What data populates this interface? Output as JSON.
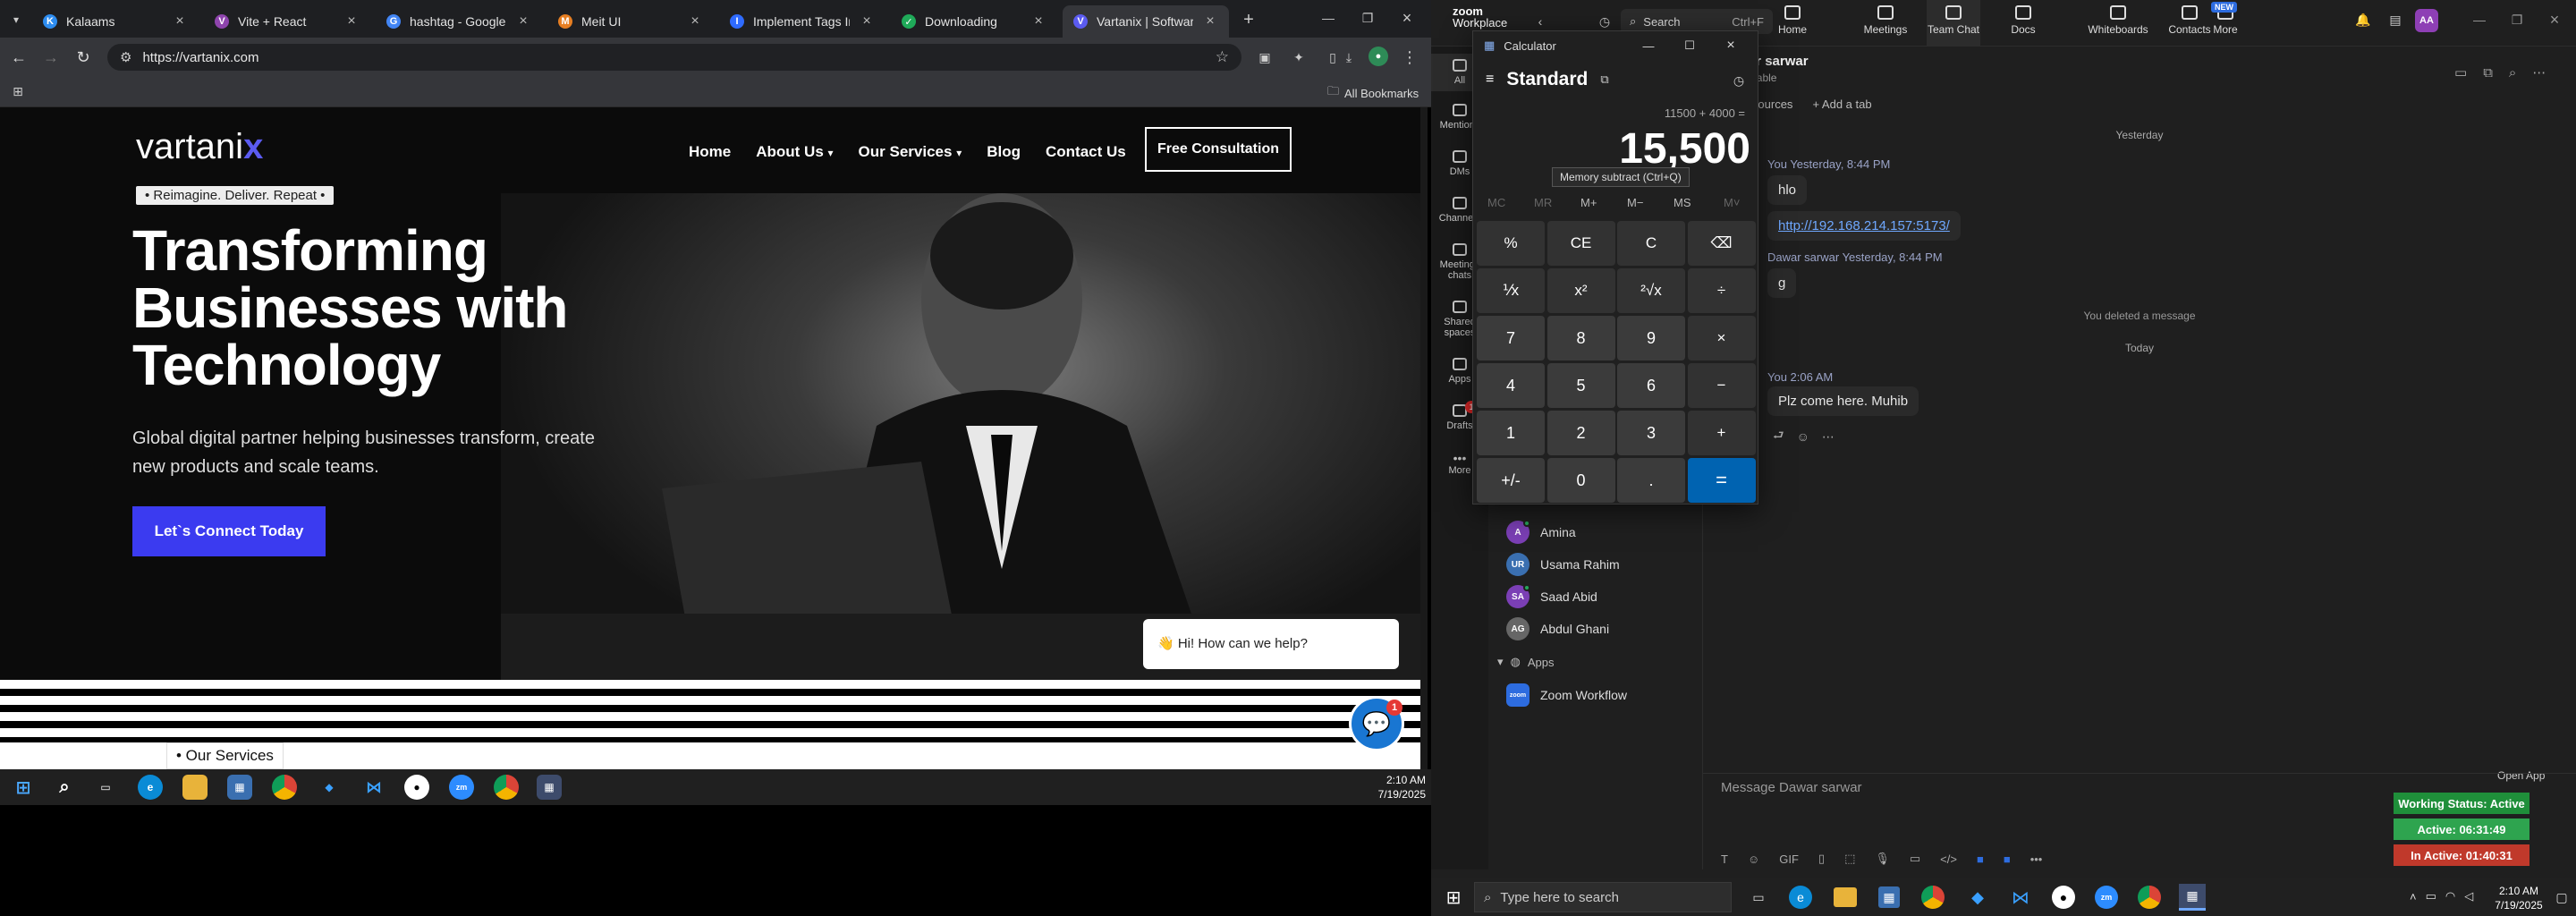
{
  "browser": {
    "tabs": [
      {
        "title": "Kalaams",
        "color": "#2d8cf0"
      },
      {
        "title": "Vite + React",
        "color": "#8e44ad"
      },
      {
        "title": "hashtag - Google Sear",
        "color": "#4285f4"
      },
      {
        "title": "Meit UI",
        "color": "#e67e22"
      },
      {
        "title": "Implement Tags Input",
        "color": "#2f6bff"
      },
      {
        "title": "Downloading",
        "color": "#1faa59"
      },
      {
        "title": "Vartanix | Software De",
        "color": "#5b5bf0"
      }
    ],
    "url": "https://vartanix.com",
    "all_bookmarks": "All Bookmarks"
  },
  "site": {
    "logo_main": "vartani",
    "logo_x": "x",
    "nav": [
      "Home",
      "About Us",
      "Our Services",
      "Blog",
      "Contact Us"
    ],
    "nav_dropdowns": [
      false,
      true,
      true,
      false,
      false
    ],
    "cta": "Free Consultation",
    "tagline": "• Reimagine. Deliver. Repeat •",
    "hero_line1": "Transforming",
    "hero_line2": "Businesses with",
    "hero_line3": "Technology",
    "sub_line1": "Global digital partner helping businesses transform, create",
    "sub_line2": "new products and scale teams.",
    "connect": "Let`s Connect Today",
    "chat_bubble": "👋 Hi! How can we help?",
    "chat_badge": "1",
    "services_tag": "• Our Services"
  },
  "left_taskbar": {
    "time": "2:10 AM",
    "date": "7/19/2025"
  },
  "zoom": {
    "brand_top": "zoom",
    "brand_bottom": "Workplace",
    "search": "Search",
    "shortcut": "Ctrl+F",
    "tabs": [
      "Home",
      "Meetings",
      "Team Chat",
      "Docs",
      "Whiteboards",
      "Contacts",
      "More"
    ],
    "new_badge": "NEW",
    "avatar": "AA",
    "side": [
      "All",
      "Mentions",
      "DMs",
      "Channels",
      "Meetings chats",
      "Shared spaces",
      "Apps",
      "Drafts",
      "More"
    ],
    "drafts_badge": "1",
    "contacts": [
      {
        "name": "Amina",
        "initials": "A",
        "color": "#7b3fb5"
      },
      {
        "name": "Usama Rahim",
        "initials": "UR",
        "color": "#3a6fb0"
      },
      {
        "name": "Saad Abid",
        "initials": "SA",
        "color": "#7b3fb5"
      },
      {
        "name": "Abdul Ghani",
        "initials": "AG",
        "color": "#666"
      }
    ],
    "apps_header": "Apps",
    "zoom_workflow": "Zoom Workflow",
    "chat": {
      "name": "Dawar sarwar",
      "status": "Available",
      "resources": "Resources",
      "add_tab": "+ Add a tab",
      "yesterday": "Yesterday",
      "m1_meta": "You Yesterday, 8:44 PM",
      "m1": "hlo",
      "m2": "http://192.168.214.157:5173/",
      "m3_name": "Dawar sarwar",
      "m3_time": "Yesterday, 8:44 PM",
      "m3": "g",
      "deleted": "You deleted a message",
      "today": "Today",
      "m4_meta": "You 2:06 AM",
      "m4": "Plz come here. Muhib",
      "compose": "Message Dawar sarwar",
      "open_app": "Open App"
    },
    "status": {
      "working": "Working Status: Active",
      "working_color": "#1f8f3a",
      "active": "Active: 06:31:49",
      "active_color": "#2ea44f",
      "inactive": "In Active: 01:40:31",
      "inactive_color": "#c0392b"
    },
    "taskbar": {
      "search": "Type here to search",
      "time": "2:10 AM",
      "date": "7/19/2025"
    }
  },
  "calculator": {
    "title": "Calculator",
    "mode": "Standard",
    "expression": "11500 + 4000 =",
    "display": "15,500",
    "tooltip": "Memory subtract (Ctrl+Q)",
    "memory": [
      "MC",
      "MR",
      "M+",
      "M−",
      "MS",
      "M˅"
    ],
    "keys": [
      "%",
      "CE",
      "C",
      "⌫",
      "⅟x",
      "x²",
      "²√x",
      "÷",
      "7",
      "8",
      "9",
      "×",
      "4",
      "5",
      "6",
      "−",
      "1",
      "2",
      "3",
      "+",
      "+/-",
      "0",
      ".",
      "="
    ]
  }
}
